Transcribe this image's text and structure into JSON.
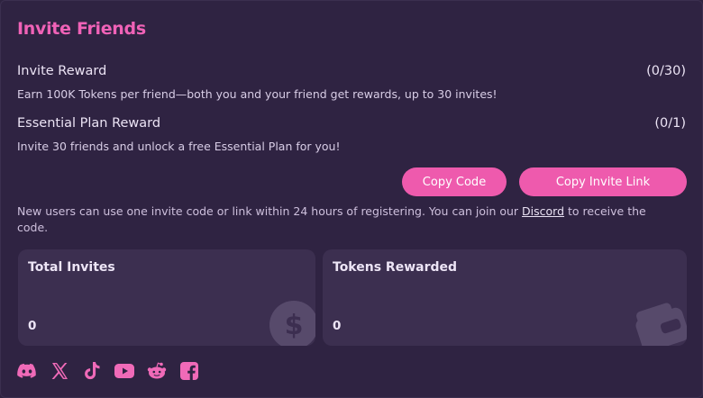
{
  "title": "Invite Friends",
  "rewards": [
    {
      "name": "Invite Reward",
      "progress": "(0/30)",
      "description": "Earn 100K Tokens per friend—both you and your friend get rewards, up to 30 invites!"
    },
    {
      "name": "Essential Plan Reward",
      "progress": "(0/1)",
      "description": "Invite 30 friends and unlock a free Essential Plan for you!"
    }
  ],
  "buttons": {
    "copy_code": "Copy Code",
    "copy_link": "Copy Invite Link"
  },
  "note": {
    "before": "New users can use one invite code or link within 24 hours of registering. You can join our ",
    "link": "Discord",
    "after": " to receive the code."
  },
  "stats": [
    {
      "label": "Total Invites",
      "value": "0",
      "icon": "dollar-coin-icon"
    },
    {
      "label": "Tokens Rewarded",
      "value": "0",
      "icon": "wallet-icon"
    }
  ],
  "socials": [
    "discord-icon",
    "x-icon",
    "tiktok-icon",
    "youtube-icon",
    "reddit-icon",
    "facebook-icon"
  ],
  "colors": {
    "background": "#2f2342",
    "accent": "#ee5aad",
    "title": "#f062b7",
    "card": "#3c2f50"
  }
}
